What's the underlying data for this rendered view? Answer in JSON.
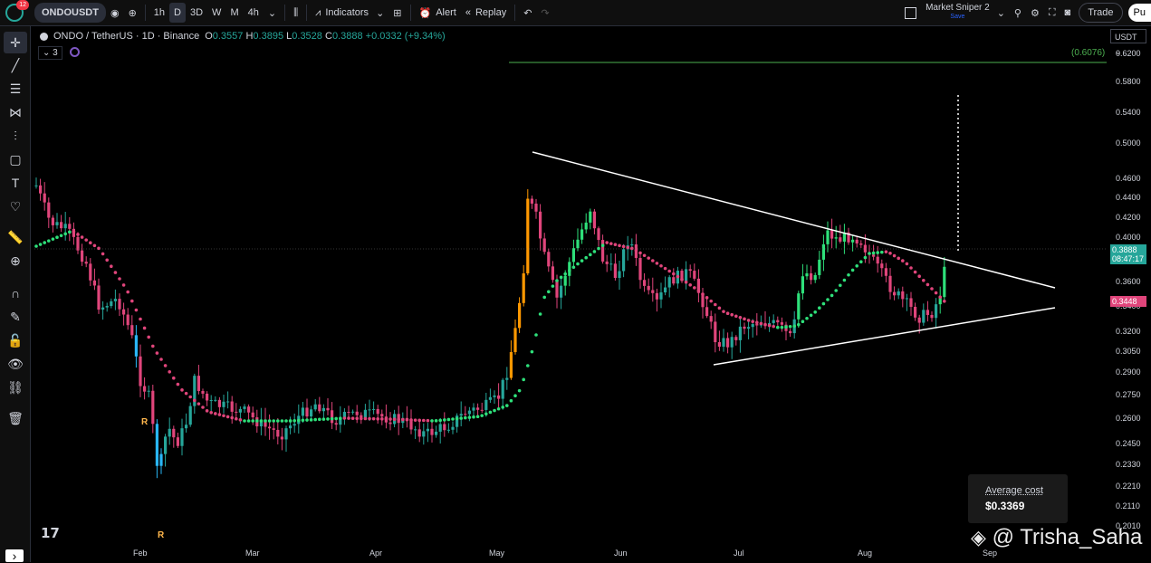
{
  "topbar": {
    "notif_count": "12",
    "symbol": "ONDOUSDT",
    "intervals": [
      "1h",
      "D",
      "3D",
      "W",
      "M",
      "4h"
    ],
    "active_interval": "D",
    "indicators_label": "Indicators",
    "alert_label": "Alert",
    "replay_label": "Replay",
    "layout_name": "Market Sniper 2",
    "layout_sub": "Save",
    "trade_label": "Trade",
    "publish_label": "Pu"
  },
  "legend": {
    "pair": "ONDO / TetherUS · 1D · Binance",
    "o_label": "O",
    "o": "0.3557",
    "h_label": "H",
    "h": "0.3895",
    "l_label": "L",
    "l": "0.3528",
    "c_label": "C",
    "c": "0.3888",
    "change": "+0.0332 (+9.34%)",
    "collapsed_count": "3"
  },
  "price_axis": {
    "currency": "USDT",
    "ticks": [
      "0.6200",
      "0.5800",
      "0.5400",
      "0.5000",
      "0.4600",
      "0.4400",
      "0.4200",
      "0.4000",
      "0.3800",
      "0.3600",
      "0.3400",
      "0.3200",
      "0.3050",
      "0.2900",
      "0.2750",
      "0.2600",
      "0.2450",
      "0.2330",
      "0.2210",
      "0.2110",
      "0.2010"
    ],
    "current_price": "0.3888",
    "countdown": "08:47:17",
    "indicator_price": "0.3448",
    "target_level": "(0.6076)"
  },
  "time_axis": {
    "months": [
      "Feb",
      "Mar",
      "Apr",
      "May",
      "Jun",
      "Jul",
      "Aug",
      "Sep"
    ]
  },
  "markers": {
    "r_label": "R"
  },
  "average_cost": {
    "title": "Average cost",
    "value": "$0.3369"
  },
  "watermark": "@ Trisha_Saha",
  "colors": {
    "up": "#26a69a",
    "up_bright": "#2ee07a",
    "down": "#e0457b",
    "orange": "#ff9800",
    "blue": "#29b6f6",
    "line_green": "#4caf50"
  }
}
